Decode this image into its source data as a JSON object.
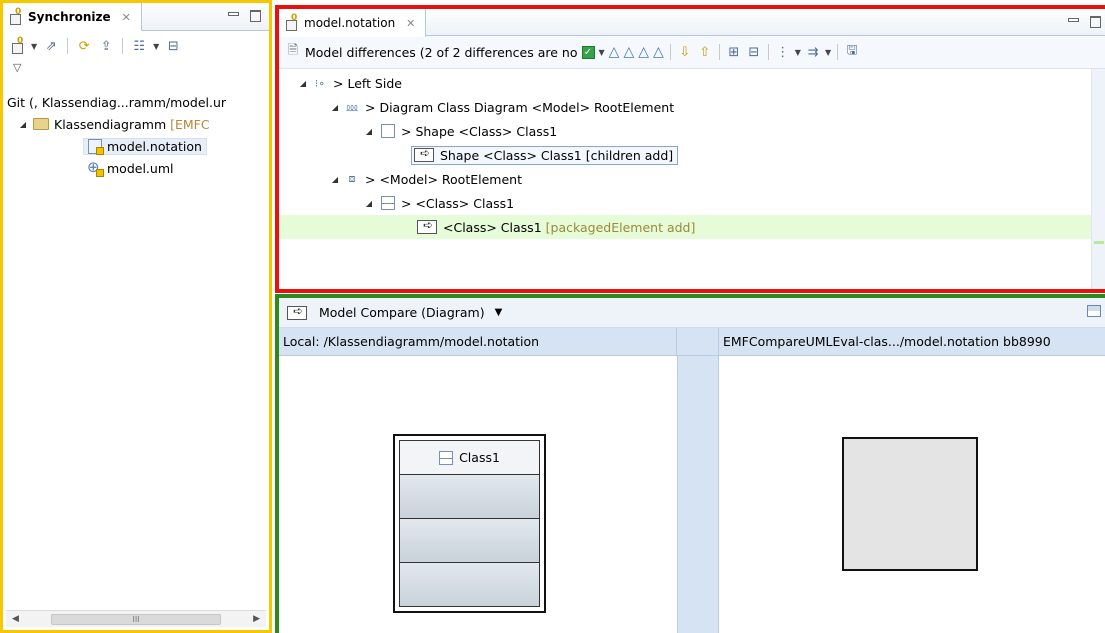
{
  "sync_view": {
    "title": "Synchronize",
    "close": "✕",
    "tree": {
      "root": "Git (, Klassendiag...ramm/model.ur",
      "project": "Klassendiagramm",
      "project_decor": "[EMFC",
      "files": [
        "model.notation",
        "model.uml"
      ]
    },
    "scroll_label": "III"
  },
  "editor": {
    "tab_title": "model.notation",
    "close": "✕",
    "toolbar_title": "Model differences  (2 of 2 differences are no",
    "tree": {
      "left_side": "> Left Side",
      "diagram": "> Diagram Class Diagram <Model> RootElement",
      "shape": "> Shape <Class> Class1",
      "shape_add": "Shape <Class> Class1 [children add]",
      "model": "> <Model> RootElement",
      "class": "> <Class> Class1",
      "class_add": "<Class> Class1",
      "class_add_detail": "[packagedElement add]"
    }
  },
  "diagram_viewer": {
    "title": "Model Compare (Diagram)",
    "left_header": "Local: /Klassendiagramm/model.notation",
    "right_header": "EMFCompareUMLEval-clas.../model.notation bb8990",
    "class_name": "Class1"
  },
  "colors": {
    "left_border": "#f5c800",
    "editor_border": "#e8110f",
    "diagram_border": "#2a8a1e",
    "added_highlight": "#e6fbd7"
  }
}
